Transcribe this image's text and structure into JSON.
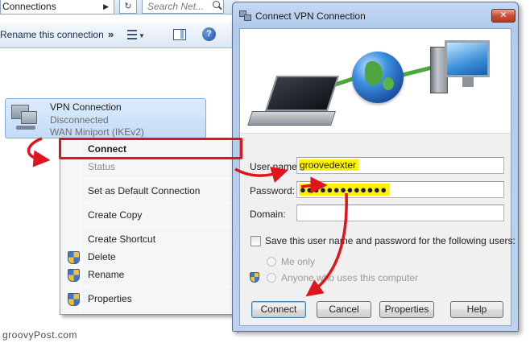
{
  "explorer": {
    "address_crumb": "Connections",
    "search_placeholder": "Search Net...",
    "command_rename": "Rename this connection",
    "command_more": "»",
    "connection": {
      "name": "VPN Connection",
      "status": "Disconnected",
      "device": "WAN Miniport (IKEv2)"
    }
  },
  "context_menu": {
    "items": [
      {
        "label": "Connect",
        "bold": true
      },
      {
        "label": "Status",
        "disabled": true
      },
      {
        "label": "Set as Default Connection"
      },
      {
        "label": "Create Copy"
      },
      {
        "label": "Create Shortcut"
      },
      {
        "label": "Delete",
        "icon": "uac-shield-icon"
      },
      {
        "label": "Rename",
        "icon": "uac-shield-icon"
      },
      {
        "label": "Properties",
        "icon": "uac-shield-icon"
      }
    ]
  },
  "dialog": {
    "title": "Connect VPN Connection",
    "close_glyph": "✕",
    "username_label": "User name:",
    "username_value": "groovedexter",
    "password_label": "Password:",
    "password_value": "●●●●●●●●●●●●●",
    "domain_label": "Domain:",
    "domain_value": "",
    "save_checkbox_label": "Save this user name and password for the following users:",
    "save_checked": false,
    "radio_me_only": "Me only",
    "radio_anyone": "Anyone who uses this computer",
    "buttons": {
      "connect": "Connect",
      "cancel": "Cancel",
      "properties": "Properties",
      "help": "Help"
    }
  },
  "annotations": {
    "arrow_color": "#e0141d",
    "highlight_color": "#fff200"
  },
  "watermark": "groovyPost.com"
}
